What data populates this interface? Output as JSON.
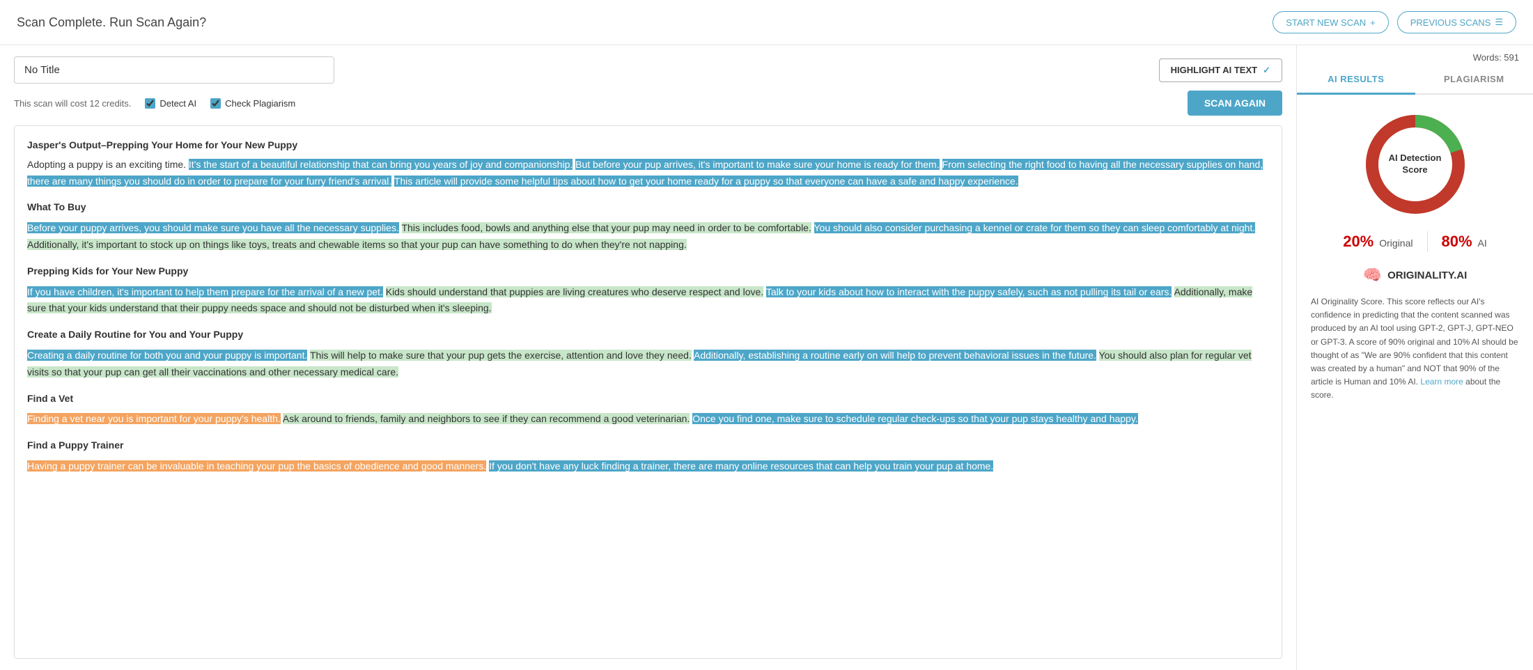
{
  "header": {
    "title": "Scan Complete. Run Scan Again?",
    "start_new_scan": "START NEW SCAN",
    "previous_scans": "PREVIOUS SCANS"
  },
  "toolbar": {
    "title_placeholder": "No Title",
    "title_value": "No Title",
    "highlight_btn": "HIGHLIGHT AI TEXT",
    "highlight_checked": true
  },
  "controls": {
    "cost_text": "This scan will cost 12 credits.",
    "detect_ai_label": "Detect AI",
    "detect_ai_checked": true,
    "check_plagiarism_label": "Check Plagiarism",
    "check_plagiarism_checked": true,
    "scan_again_btn": "SCAN AGAIN"
  },
  "right_panel": {
    "words_label": "Words: 591",
    "tab_ai": "AI RESULTS",
    "tab_plagiarism": "PLAGIARISM",
    "donut_label_line1": "AI Detection",
    "donut_label_line2": "Score",
    "original_pct": "20%",
    "original_label": "Original",
    "ai_pct": "80%",
    "ai_label": "AI",
    "logo_text": "ORIGINALITY.AI",
    "description": "AI Originality Score. This score reflects our AI's confidence in predicting that the content scanned was produced by an AI tool using GPT-2, GPT-J, GPT-NEO or GPT-3. A score of 90% original and 10% AI should be thought of as \"We are 90% confident that this content was created by a human\" and NOT that 90% of the article is Human and 10% AI.",
    "learn_more": "Learn more",
    "about_score": "about the score."
  },
  "content": {
    "article_title": "Jasper's Output–Prepping Your Home for Your New Puppy",
    "intro": "Adopting a puppy is an exciting time.",
    "para1_ai": "It's the start of a beautiful relationship that can bring you years of joy and companionship.",
    "para1_ai2": "But before your pup arrives, it's important to make sure your home is ready for them.",
    "para1_ai3": "From selecting the right food to having all the necessary supplies on hand, there are many things you should do in order to prepare for your furry friend's arrival.",
    "para1_ai4": "This article will provide some helpful tips about how to get your home ready for a puppy so that everyone can have a safe and happy experience.",
    "heading1": "What To Buy",
    "para2_ai": "Before your puppy arrives, you should make sure you have all the necessary supplies.",
    "para2_human": "This includes food, bowls and anything else that your pup may need in order to be comfortable.",
    "para2_ai2": "You should also consider purchasing a kennel or crate for them so they can sleep comfortably at night.",
    "para2_human2": "Additionally, it's important to stock up on things like toys, treats and chewable items so that your pup can have something to do when they're not napping.",
    "heading2": "Prepping Kids for Your New Puppy",
    "para3_ai": "If you have children, it's important to help them prepare for the arrival of a new pet.",
    "para3_human": "Kids should understand that puppies are living creatures who deserve respect and love.",
    "para3_ai2": "Talk to your kids about how to interact with the puppy safely, such as not pulling its tail or ears.",
    "para3_human2": "Additionally, make sure that your kids understand that their puppy needs space and should not be disturbed when it's sleeping.",
    "heading3": "Create a Daily Routine for You and Your Puppy",
    "para4_ai": "Creating a daily routine for both you and your puppy is important.",
    "para4_human": "This will help to make sure that your pup gets the exercise, attention and love they need.",
    "para4_ai2": "Additionally, establishing a routine early on will help to prevent behavioral issues in the future.",
    "para4_human2": "You should also plan for regular vet visits so that your pup can get all their vaccinations and other necessary medical care.",
    "heading4": "Find a Vet",
    "para5_orange": "Finding a vet near you is important for your puppy's health.",
    "para5_human": "Ask around to friends, family and neighbors to see if they can recommend a good veterinarian.",
    "para5_ai": "Once you find one, make sure to schedule regular check-ups so that your pup stays healthy and happy.",
    "heading5": "Find a Puppy Trainer",
    "para6_orange": "Having a puppy trainer can be invaluable in teaching your pup the basics of obedience and good manners.",
    "para6_ai": "If you don't have any luck finding a trainer, there are many online resources that can help you train your pup at home."
  }
}
